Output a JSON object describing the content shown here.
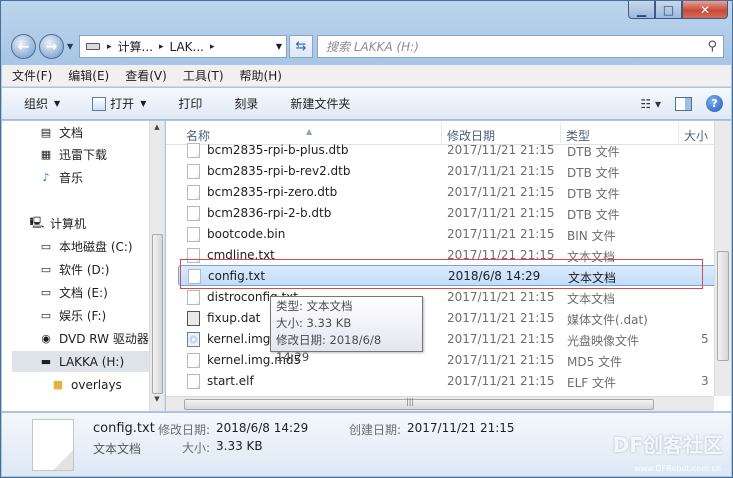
{
  "search": {
    "placeholder": "搜索 LAKKA (H:)"
  },
  "address": {
    "segments": [
      "计算...",
      "LAK..."
    ]
  },
  "menu": [
    "文件(F)",
    "编辑(E)",
    "查看(V)",
    "工具(T)",
    "帮助(H)"
  ],
  "toolbar": {
    "organize": "组织",
    "open": "打开",
    "print": "打印",
    "burn": "刻录",
    "new_folder": "新建文件夹"
  },
  "nav": {
    "documents": "文档",
    "xunlei": "迅雷下载",
    "music": "音乐",
    "computer": "计算机",
    "local_c": "本地磁盘 (C:)",
    "soft_d": "软件 (D:)",
    "docs_e": "文档 (E:)",
    "ent_f": "娱乐 (F:)",
    "dvd_g": "DVD RW 驱动器",
    "lakka_h": "LAKKA (H:)",
    "overlays": "overlays"
  },
  "columns": {
    "name": "名称",
    "date": "修改日期",
    "type": "类型",
    "size": "大小"
  },
  "files": [
    {
      "name": "bcm2835-rpi-b-plus.dtb",
      "date": "2017/11/21 21:15",
      "type": "DTB 文件",
      "size": ""
    },
    {
      "name": "bcm2835-rpi-b-rev2.dtb",
      "date": "2017/11/21 21:15",
      "type": "DTB 文件",
      "size": ""
    },
    {
      "name": "bcm2835-rpi-zero.dtb",
      "date": "2017/11/21 21:15",
      "type": "DTB 文件",
      "size": ""
    },
    {
      "name": "bcm2836-rpi-2-b.dtb",
      "date": "2017/11/21 21:15",
      "type": "DTB 文件",
      "size": ""
    },
    {
      "name": "bootcode.bin",
      "date": "2017/11/21 21:15",
      "type": "BIN 文件",
      "size": ""
    },
    {
      "name": "cmdline.txt",
      "date": "2017/11/21 21:15",
      "type": "文本文档",
      "size": ""
    },
    {
      "name": "config.txt",
      "date": "2018/6/8 14:29",
      "type": "文本文档",
      "size": ""
    },
    {
      "name": "distroconfig.txt",
      "date": "2017/11/21 21:15",
      "type": "文本文档",
      "size": ""
    },
    {
      "name": "fixup.dat",
      "date": "2017/11/21 21:15",
      "type": "媒体文件(.dat)",
      "size": ""
    },
    {
      "name": "kernel.img",
      "date": "2017/11/21 21:15",
      "type": "光盘映像文件",
      "size": "5"
    },
    {
      "name": "kernel.img.md5",
      "date": "2017/11/21 21:15",
      "type": "MD5 文件",
      "size": ""
    },
    {
      "name": "start.elf",
      "date": "2017/11/21 21:15",
      "type": "ELF 文件",
      "size": "3"
    }
  ],
  "tooltip": {
    "type_line": "类型: 文本文档",
    "size_line": "大小: 3.33 KB",
    "date_line": "修改日期: 2018/6/8 14:29"
  },
  "details": {
    "file_name": "config.txt",
    "file_type": "文本文档",
    "modified_label": "修改日期:",
    "modified_value": "2018/6/8 14:29",
    "size_label": "大小:",
    "size_value": "3.33 KB",
    "created_label": "创建日期:",
    "created_value": "2017/11/21 21:15"
  },
  "watermark": {
    "text": "DF创客社区",
    "url": "www.DFRobot.com.cn"
  }
}
